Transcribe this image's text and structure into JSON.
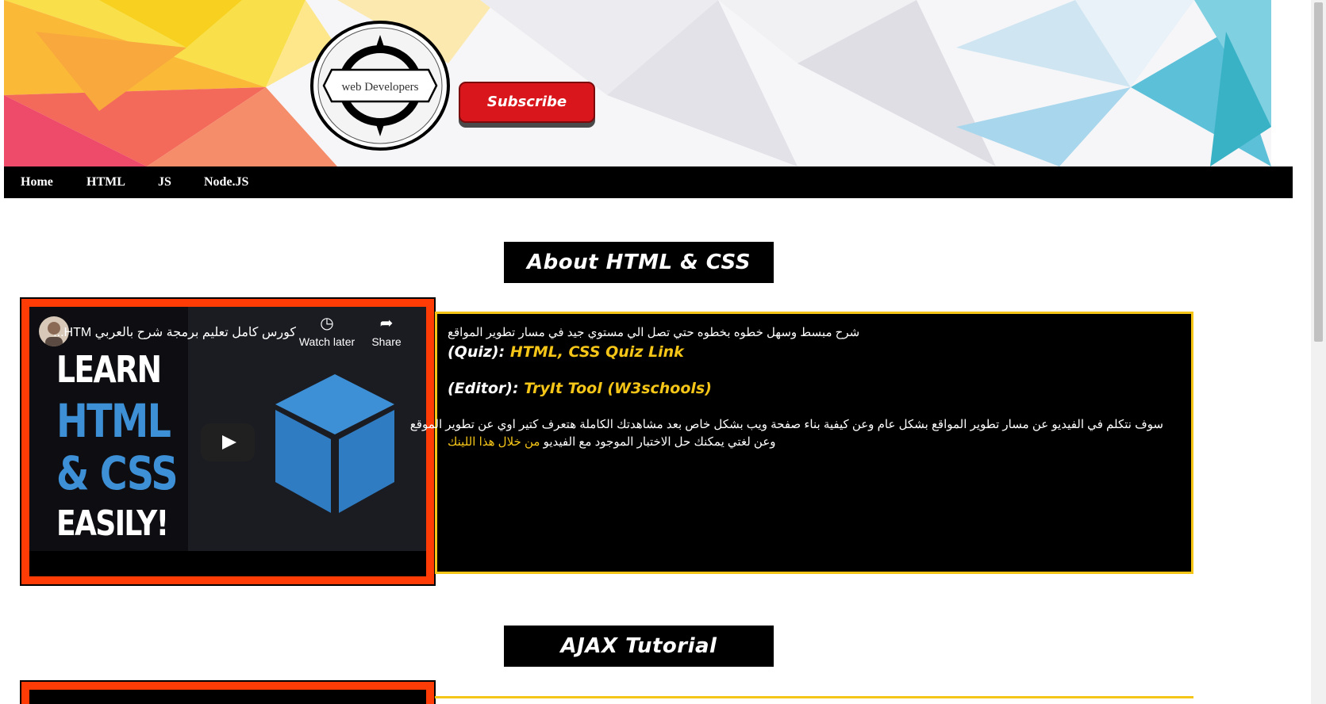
{
  "header": {
    "logo_text": "web Developers",
    "subscribe_label": "Subscribe"
  },
  "nav": {
    "items": [
      {
        "label": "Home"
      },
      {
        "label": "HTML"
      },
      {
        "label": "JS"
      },
      {
        "label": "Node.JS"
      }
    ]
  },
  "sections": [
    {
      "heading": "About HTML & CSS",
      "video": {
        "title": "كورس كامل تعليم برمجة شرح بالعربي HTM...",
        "watch_later_label": "Watch later",
        "share_label": "Share",
        "thumb_lines": [
          "LEARN",
          "HTML",
          "& CSS",
          "EASILY!"
        ]
      },
      "panel": {
        "intro": "شرح مبسط وسهل خطوه بخطوه حتي تصل الي مستوي جيد في مسار تطوير المواقع",
        "quiz_label": "(Quiz):",
        "quiz_link": "HTML, CSS Quiz Link",
        "editor_label": "(Editor):",
        "editor_link": "TryIt Tool (W3schools)",
        "desc_line1": "سوف نتكلم في الفيديو عن مسار تطوير المواقع بشكل عام وعن كيفية بناء صفحة ويب بشكل خاص بعد مشاهدتك الكاملة هتعرف كتير اوي عن تطوير الموقع",
        "desc_line2": "وعن لغتي يمكنك حل الاختبار الموجود مع الفيديو",
        "desc_link": "من خلال هذا اللينك"
      }
    },
    {
      "heading": "AJAX Tutorial"
    }
  ],
  "colors": {
    "accent_red": "#ff3b06",
    "accent_yellow": "#f5c518",
    "subscribe_red": "#d8161c"
  }
}
